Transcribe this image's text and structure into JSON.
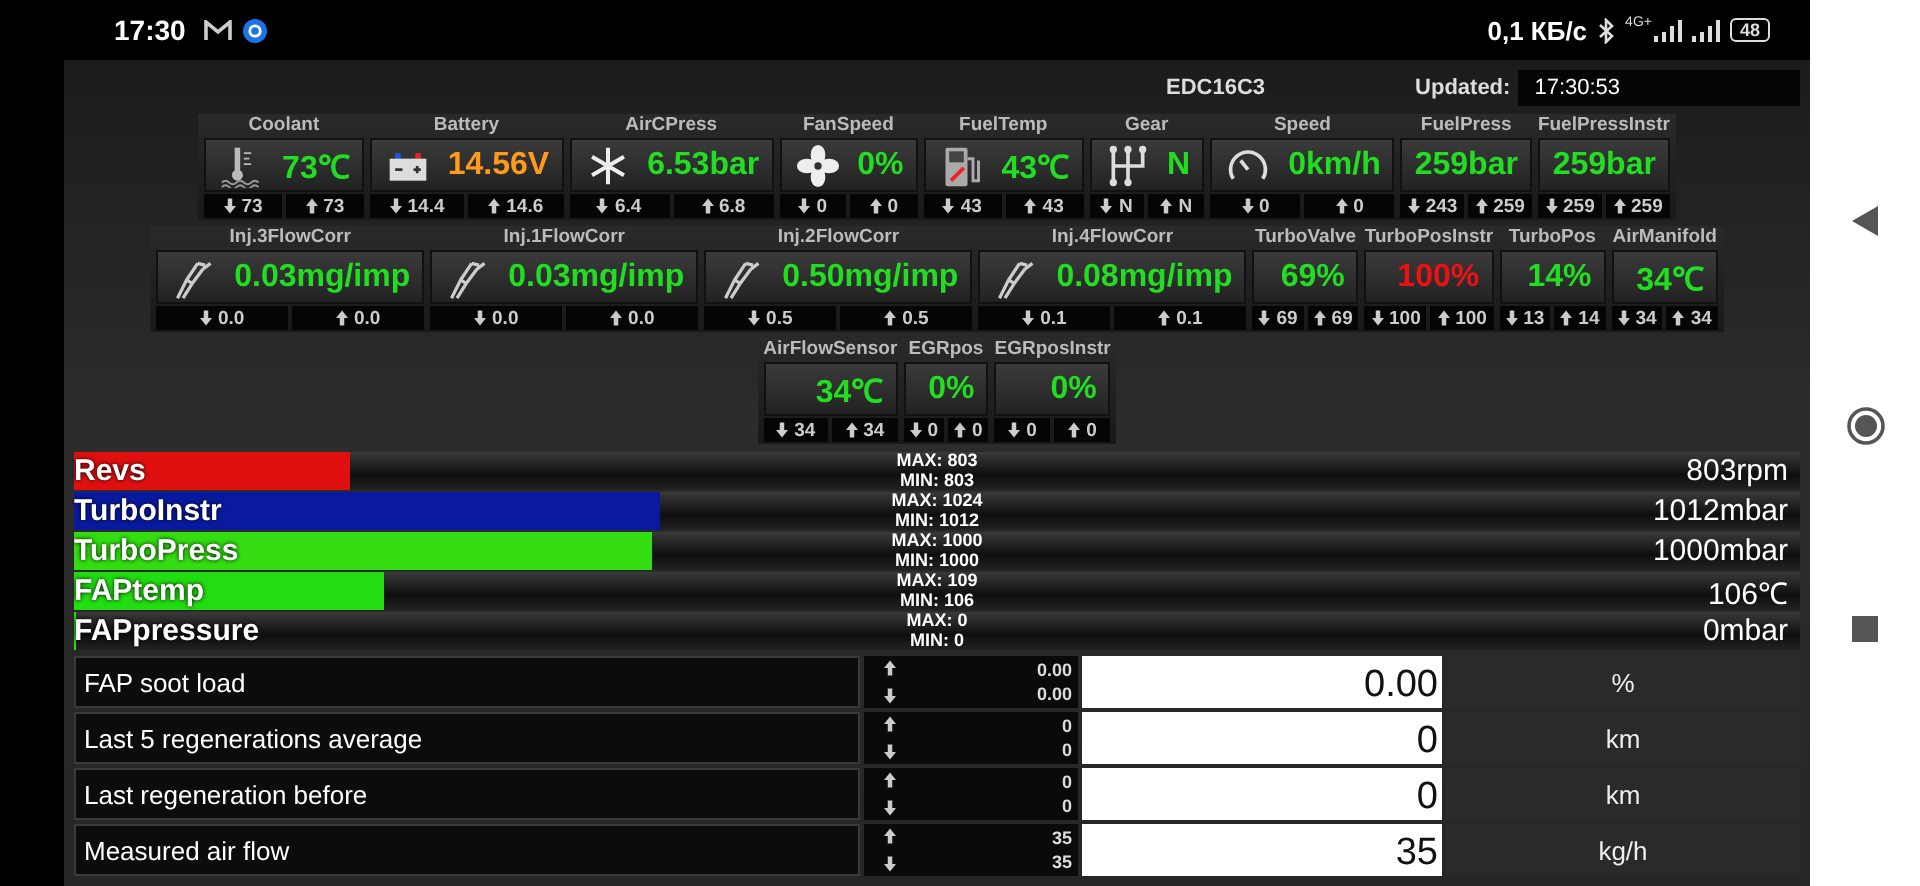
{
  "status_bar": {
    "time": "17:30",
    "net_speed": "0,1 КБ/с",
    "network_type": "4G+",
    "battery": "48"
  },
  "header": {
    "ecu": "EDC16C3",
    "updated_label": "Updated:",
    "updated_time": "17:30:53"
  },
  "gauge_rows": [
    [
      {
        "label": "Coolant",
        "kind": "thermometer",
        "value": "73℃",
        "color": "#22dd22",
        "min": "73",
        "max": "73"
      },
      {
        "label": "Battery",
        "kind": "battery",
        "value": "14.56V",
        "color": "#ff9a1a",
        "min": "14.4",
        "max": "14.6"
      },
      {
        "label": "AirCPress",
        "kind": "snowflake",
        "value": "6.53bar",
        "color": "#22dd22",
        "min": "6.4",
        "max": "6.8"
      },
      {
        "label": "FanSpeed",
        "kind": "fan",
        "value": "0%",
        "color": "#22dd22",
        "min": "0",
        "max": "0"
      },
      {
        "label": "FuelTemp",
        "kind": "fuel-pump",
        "value": "43℃",
        "color": "#22dd22",
        "min": "43",
        "max": "43"
      },
      {
        "label": "Gear",
        "kind": "gearshift",
        "value": "N",
        "color": "#22dd22",
        "min": "N",
        "max": "N"
      },
      {
        "label": "Speed",
        "kind": "speedometer",
        "value": "0km/h",
        "color": "#22dd22",
        "min": "0",
        "max": "0"
      },
      {
        "label": "FuelPress",
        "kind": "plain",
        "value": "259bar",
        "color": "#22dd22",
        "min": "243",
        "max": "259"
      },
      {
        "label": "FuelPressInstr",
        "kind": "plain",
        "value": "259bar",
        "color": "#22dd22",
        "min": "259",
        "max": "259"
      }
    ],
    [
      {
        "label": "Inj.3FlowCorr",
        "kind": "injector",
        "value": "0.03mg/imp",
        "color": "#22dd22",
        "min": "0.0",
        "max": "0.0"
      },
      {
        "label": "Inj.1FlowCorr",
        "kind": "injector",
        "value": "0.03mg/imp",
        "color": "#22dd22",
        "min": "0.0",
        "max": "0.0"
      },
      {
        "label": "Inj.2FlowCorr",
        "kind": "injector",
        "value": "0.50mg/imp",
        "color": "#22dd22",
        "min": "0.5",
        "max": "0.5"
      },
      {
        "label": "Inj.4FlowCorr",
        "kind": "injector",
        "value": "0.08mg/imp",
        "color": "#22dd22",
        "min": "0.1",
        "max": "0.1"
      },
      {
        "label": "TurboValve",
        "kind": "plain",
        "value": "69%",
        "color": "#22dd22",
        "min": "69",
        "max": "69"
      },
      {
        "label": "TurboPosInstr",
        "kind": "plain",
        "value": "100%",
        "color": "#ee1111",
        "min": "100",
        "max": "100"
      },
      {
        "label": "TurboPos",
        "kind": "plain",
        "value": "14%",
        "color": "#22dd22",
        "min": "13",
        "max": "14"
      },
      {
        "label": "AirManifold",
        "kind": "plain",
        "value": "34℃",
        "color": "#22dd22",
        "min": "34",
        "max": "34"
      }
    ],
    [
      {
        "label": "AirFlowSensor",
        "kind": "plain",
        "value": "34℃",
        "color": "#22dd22",
        "min": "34",
        "max": "34"
      },
      {
        "label": "EGRpos",
        "kind": "plain",
        "value": "0%",
        "color": "#22dd22",
        "min": "0",
        "max": "0"
      },
      {
        "label": "EGRposInstr",
        "kind": "plain",
        "value": "0%",
        "color": "#22dd22",
        "min": "0",
        "max": "0"
      }
    ]
  ],
  "bars": [
    {
      "label": "Revs",
      "level": 0.16,
      "color": "#e01010",
      "max": "MAX: 803",
      "min": "MIN: 803",
      "reading": "803rpm"
    },
    {
      "label": "TurboInstr",
      "level": 0.34,
      "color": "#0a1aa0",
      "max": "MAX: 1024",
      "min": "MIN: 1012",
      "reading": "1012mbar"
    },
    {
      "label": "TurboPress",
      "level": 0.335,
      "color": "#33dd11",
      "max": "MAX: 1000",
      "min": "MIN: 1000",
      "reading": "1000mbar"
    },
    {
      "label": "FAPtemp",
      "level": 0.18,
      "color": "#22dd11",
      "max": "MAX: 109",
      "min": "MIN: 106",
      "reading": "106℃"
    },
    {
      "label": "FAPpressure",
      "level": 0,
      "max": "MAX: 0",
      "min": "MIN: 0",
      "reading": "0mbar"
    }
  ],
  "table": {
    "rows": [
      {
        "name": "FAP soot load",
        "max": "0.00",
        "min": "0.00",
        "value": "0.00",
        "unit": "%"
      },
      {
        "name": "Last 5 regenerations average",
        "max": "0",
        "min": "0",
        "value": "0",
        "unit": "km"
      },
      {
        "name": "Last regeneration before",
        "max": "0",
        "min": "0",
        "value": "0",
        "unit": "km"
      },
      {
        "name": "Measured air flow",
        "max": "35",
        "min": "35",
        "value": "35",
        "unit": "kg/h"
      }
    ]
  }
}
